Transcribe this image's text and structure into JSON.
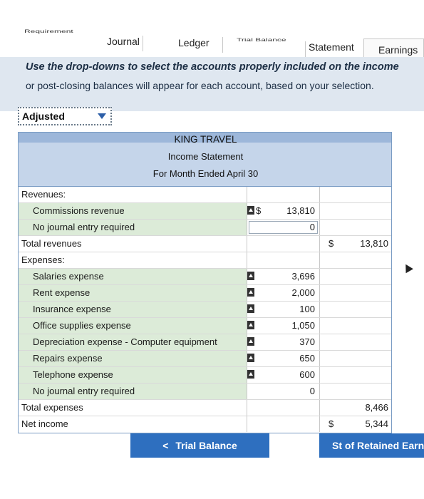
{
  "tabs": {
    "requirement": "Requirement",
    "journal": "Journal",
    "ledger": "Ledger",
    "trial_balance": "Trial Balance",
    "statement": "Statement",
    "earnings": "Earnings"
  },
  "instructions": {
    "line1": "Use the drop-downs to select the accounts properly included on the income",
    "line2": "or post-closing balances will appear for each account, based on your selection."
  },
  "dropdown": {
    "selected": "Adjusted"
  },
  "statement": {
    "company": "KING TRAVEL",
    "title": "Income Statement",
    "period": "For Month Ended April 30",
    "revenues_label": "Revenues:",
    "revenues": [
      {
        "account": "Commissions revenue",
        "amount": "13,810",
        "dollar": "$"
      },
      {
        "account": "No journal entry required",
        "amount": "0",
        "dollar": ""
      }
    ],
    "total_revenues_label": "Total revenues",
    "total_revenues": "13,810",
    "total_revenues_dollar": "$",
    "expenses_label": "Expenses:",
    "expenses": [
      {
        "account": "Salaries expense",
        "amount": "3,696"
      },
      {
        "account": "Rent expense",
        "amount": "2,000"
      },
      {
        "account": "Insurance expense",
        "amount": "100"
      },
      {
        "account": "Office supplies expense",
        "amount": "1,050"
      },
      {
        "account": "Depreciation expense - Computer equipment",
        "amount": "370"
      },
      {
        "account": "Repairs expense",
        "amount": "650"
      },
      {
        "account": "Telephone expense",
        "amount": "600"
      },
      {
        "account": "No journal entry required",
        "amount": "0"
      }
    ],
    "total_expenses_label": "Total expenses",
    "total_expenses": "8,466",
    "net_income_label": "Net income",
    "net_income": "5,344",
    "net_income_dollar": "$"
  },
  "buttons": {
    "prev": "Trial Balance",
    "prev_arrow": "<",
    "next": "St of Retained Earnin"
  }
}
